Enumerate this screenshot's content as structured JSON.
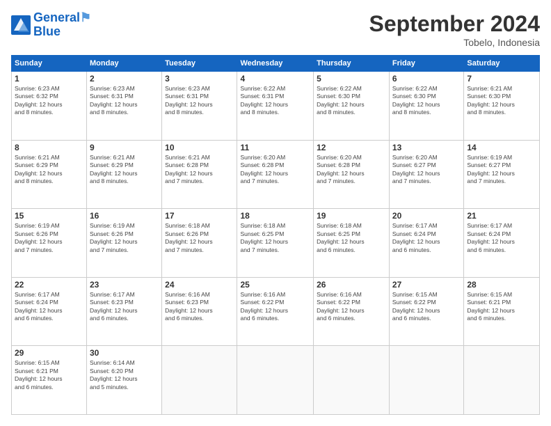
{
  "header": {
    "logo_line1": "General",
    "logo_line2": "Blue",
    "month_title": "September 2024",
    "location": "Tobelo, Indonesia"
  },
  "days_of_week": [
    "Sunday",
    "Monday",
    "Tuesday",
    "Wednesday",
    "Thursday",
    "Friday",
    "Saturday"
  ],
  "weeks": [
    [
      {
        "day": "1",
        "sunrise": "6:23 AM",
        "sunset": "6:32 PM",
        "daylight": "12 hours and 8 minutes."
      },
      {
        "day": "2",
        "sunrise": "6:23 AM",
        "sunset": "6:31 PM",
        "daylight": "12 hours and 8 minutes."
      },
      {
        "day": "3",
        "sunrise": "6:23 AM",
        "sunset": "6:31 PM",
        "daylight": "12 hours and 8 minutes."
      },
      {
        "day": "4",
        "sunrise": "6:22 AM",
        "sunset": "6:31 PM",
        "daylight": "12 hours and 8 minutes."
      },
      {
        "day": "5",
        "sunrise": "6:22 AM",
        "sunset": "6:30 PM",
        "daylight": "12 hours and 8 minutes."
      },
      {
        "day": "6",
        "sunrise": "6:22 AM",
        "sunset": "6:30 PM",
        "daylight": "12 hours and 8 minutes."
      },
      {
        "day": "7",
        "sunrise": "6:21 AM",
        "sunset": "6:30 PM",
        "daylight": "12 hours and 8 minutes."
      }
    ],
    [
      {
        "day": "8",
        "sunrise": "6:21 AM",
        "sunset": "6:29 PM",
        "daylight": "12 hours and 8 minutes."
      },
      {
        "day": "9",
        "sunrise": "6:21 AM",
        "sunset": "6:29 PM",
        "daylight": "12 hours and 8 minutes."
      },
      {
        "day": "10",
        "sunrise": "6:21 AM",
        "sunset": "6:28 PM",
        "daylight": "12 hours and 7 minutes."
      },
      {
        "day": "11",
        "sunrise": "6:20 AM",
        "sunset": "6:28 PM",
        "daylight": "12 hours and 7 minutes."
      },
      {
        "day": "12",
        "sunrise": "6:20 AM",
        "sunset": "6:28 PM",
        "daylight": "12 hours and 7 minutes."
      },
      {
        "day": "13",
        "sunrise": "6:20 AM",
        "sunset": "6:27 PM",
        "daylight": "12 hours and 7 minutes."
      },
      {
        "day": "14",
        "sunrise": "6:19 AM",
        "sunset": "6:27 PM",
        "daylight": "12 hours and 7 minutes."
      }
    ],
    [
      {
        "day": "15",
        "sunrise": "6:19 AM",
        "sunset": "6:26 PM",
        "daylight": "12 hours and 7 minutes."
      },
      {
        "day": "16",
        "sunrise": "6:19 AM",
        "sunset": "6:26 PM",
        "daylight": "12 hours and 7 minutes."
      },
      {
        "day": "17",
        "sunrise": "6:18 AM",
        "sunset": "6:26 PM",
        "daylight": "12 hours and 7 minutes."
      },
      {
        "day": "18",
        "sunrise": "6:18 AM",
        "sunset": "6:25 PM",
        "daylight": "12 hours and 7 minutes."
      },
      {
        "day": "19",
        "sunrise": "6:18 AM",
        "sunset": "6:25 PM",
        "daylight": "12 hours and 6 minutes."
      },
      {
        "day": "20",
        "sunrise": "6:17 AM",
        "sunset": "6:24 PM",
        "daylight": "12 hours and 6 minutes."
      },
      {
        "day": "21",
        "sunrise": "6:17 AM",
        "sunset": "6:24 PM",
        "daylight": "12 hours and 6 minutes."
      }
    ],
    [
      {
        "day": "22",
        "sunrise": "6:17 AM",
        "sunset": "6:24 PM",
        "daylight": "12 hours and 6 minutes."
      },
      {
        "day": "23",
        "sunrise": "6:17 AM",
        "sunset": "6:23 PM",
        "daylight": "12 hours and 6 minutes."
      },
      {
        "day": "24",
        "sunrise": "6:16 AM",
        "sunset": "6:23 PM",
        "daylight": "12 hours and 6 minutes."
      },
      {
        "day": "25",
        "sunrise": "6:16 AM",
        "sunset": "6:22 PM",
        "daylight": "12 hours and 6 minutes."
      },
      {
        "day": "26",
        "sunrise": "6:16 AM",
        "sunset": "6:22 PM",
        "daylight": "12 hours and 6 minutes."
      },
      {
        "day": "27",
        "sunrise": "6:15 AM",
        "sunset": "6:22 PM",
        "daylight": "12 hours and 6 minutes."
      },
      {
        "day": "28",
        "sunrise": "6:15 AM",
        "sunset": "6:21 PM",
        "daylight": "12 hours and 6 minutes."
      }
    ],
    [
      {
        "day": "29",
        "sunrise": "6:15 AM",
        "sunset": "6:21 PM",
        "daylight": "12 hours and 6 minutes."
      },
      {
        "day": "30",
        "sunrise": "6:14 AM",
        "sunset": "6:20 PM",
        "daylight": "12 hours and 5 minutes."
      },
      null,
      null,
      null,
      null,
      null
    ]
  ]
}
